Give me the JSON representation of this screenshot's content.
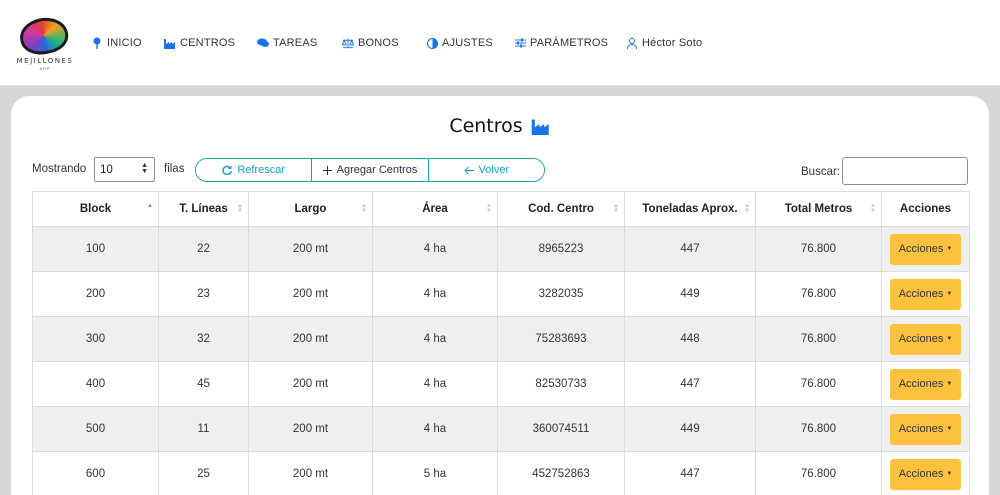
{
  "brand": {
    "name": "MEJILLONES",
    "tagline": "APP"
  },
  "nav": [
    {
      "label": "INICIO",
      "icon": "map-pin-icon"
    },
    {
      "label": "CENTROS",
      "icon": "factory-icon"
    },
    {
      "label": "TAREAS",
      "icon": "chat-icon"
    },
    {
      "label": "BONOS",
      "icon": "balance-scale-icon"
    },
    {
      "label": "AJUSTES",
      "icon": "adjust-icon"
    },
    {
      "label": "PARÁMETROS",
      "icon": "sliders-icon"
    },
    {
      "label": "Héctor Soto",
      "icon": "user-icon"
    }
  ],
  "page": {
    "title": "Centros",
    "title_icon": "factory-icon"
  },
  "controls": {
    "showing_label": "Mostrando",
    "rows_value": "10",
    "rows_label": "filas",
    "refresh_label": "Refrescar",
    "add_label": "Agregar Centros",
    "back_label": "Volver",
    "search_label": "Buscar:",
    "search_value": ""
  },
  "table": {
    "columns": [
      "Block",
      "T. Líneas",
      "Largo",
      "Área",
      "Cod. Centro",
      "Toneladas Aprox.",
      "Total Metros",
      "Acciones"
    ],
    "sorted_column": "Block",
    "action_label": "Acciones",
    "rows": [
      [
        "100",
        "22",
        "200 mt",
        "4 ha",
        "8965223",
        "447",
        "76.800"
      ],
      [
        "200",
        "23",
        "200 mt",
        "4 ha",
        "3282035",
        "449",
        "76.800"
      ],
      [
        "300",
        "32",
        "200 mt",
        "4 ha",
        "75283693",
        "448",
        "76.800"
      ],
      [
        "400",
        "45",
        "200 mt",
        "4 ha",
        "82530733",
        "447",
        "76.800"
      ],
      [
        "500",
        "11",
        "200 mt",
        "4 ha",
        "360074511",
        "449",
        "76.800"
      ],
      [
        "600",
        "25",
        "200 mt",
        "5 ha",
        "452752863",
        "447",
        "76.800"
      ]
    ]
  },
  "colors": {
    "accent": "#1a73e8",
    "teal": "#17a2b8",
    "action": "#fcc23d",
    "background": "#d6d6d6"
  }
}
